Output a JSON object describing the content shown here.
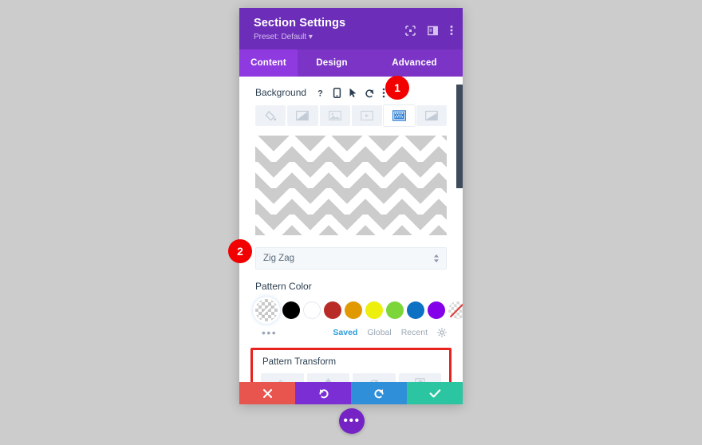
{
  "page": {
    "background_pattern": "zig-zag-chevron",
    "pattern_color": "#cccccc",
    "base_color": "#ffffff"
  },
  "panel": {
    "title": "Section Settings",
    "preset": "Preset: Default ▾",
    "header_icons": [
      {
        "name": "fullscreen-icon",
        "glyph": "expand"
      },
      {
        "name": "layout-toggle-icon",
        "glyph": "panel"
      },
      {
        "name": "more-options-icon",
        "glyph": "kebab"
      }
    ],
    "tabs": [
      {
        "label": "Content",
        "active": true
      },
      {
        "label": "Design",
        "active": false
      },
      {
        "label": "Advanced",
        "active": false
      }
    ],
    "accent": {
      "header_purple": "#6c2eb9",
      "tabbar_purple": "#7b34c6",
      "tab_active_purple": "#8f3ae0"
    }
  },
  "background_group": {
    "label": "Background",
    "row_icons": [
      {
        "name": "help-icon",
        "label": "?"
      },
      {
        "name": "responsive-icon",
        "label": "mobile"
      },
      {
        "name": "hover-icon",
        "label": "cursor"
      },
      {
        "name": "reset-icon",
        "label": "undo"
      },
      {
        "name": "more-icon",
        "label": "kebab"
      }
    ],
    "type_tabs": [
      {
        "name": "background-color",
        "active": false
      },
      {
        "name": "background-gradient",
        "active": false
      },
      {
        "name": "background-image",
        "active": false
      },
      {
        "name": "background-video",
        "active": false
      },
      {
        "name": "background-pattern",
        "active": true
      },
      {
        "name": "background-mask",
        "active": false
      }
    ]
  },
  "pattern": {
    "preview_alt": "Zig Zag pattern preview",
    "select_value": "Zig Zag",
    "color_label": "Pattern Color",
    "swatches": [
      {
        "name": "swatch-current",
        "color": "#cccccc",
        "kind": "current",
        "selected": true
      },
      {
        "name": "swatch-black",
        "color": "#000000",
        "kind": "solid"
      },
      {
        "name": "swatch-white",
        "color": "#ffffff",
        "kind": "solid"
      },
      {
        "name": "swatch-red",
        "color": "#b92b27",
        "kind": "solid"
      },
      {
        "name": "swatch-orange",
        "color": "#e09900",
        "kind": "solid"
      },
      {
        "name": "swatch-yellow",
        "color": "#edef0c",
        "kind": "solid"
      },
      {
        "name": "swatch-green",
        "color": "#7cd63a",
        "kind": "solid"
      },
      {
        "name": "swatch-blue",
        "color": "#0c71c3",
        "kind": "solid"
      },
      {
        "name": "swatch-purple",
        "color": "#8300e9",
        "kind": "solid"
      },
      {
        "name": "swatch-transparent",
        "color": "transparent",
        "kind": "transparent"
      }
    ],
    "more_dots": "•••",
    "palette_links": [
      {
        "label": "Saved",
        "active": true
      },
      {
        "label": "Global",
        "active": false
      },
      {
        "label": "Recent",
        "active": false
      }
    ],
    "settings_icon": "gear-icon"
  },
  "transform": {
    "label": "Pattern Transform",
    "highlight_color": "#e8231f",
    "buttons": [
      {
        "name": "flip-horizontal-button"
      },
      {
        "name": "flip-vertical-button"
      },
      {
        "name": "rotate-button"
      },
      {
        "name": "invert-button"
      }
    ]
  },
  "actions": [
    {
      "name": "cancel-button",
      "glyph": "✕",
      "color": "#e8554e"
    },
    {
      "name": "undo-button",
      "glyph": "↺",
      "color": "#7b2ed4"
    },
    {
      "name": "redo-button",
      "glyph": "↻",
      "color": "#2f8fd8"
    },
    {
      "name": "save-button",
      "glyph": "✓",
      "color": "#2cc5a2"
    }
  ],
  "fab": {
    "label": "•••"
  },
  "badges": [
    {
      "number": "1"
    },
    {
      "number": "2"
    }
  ]
}
